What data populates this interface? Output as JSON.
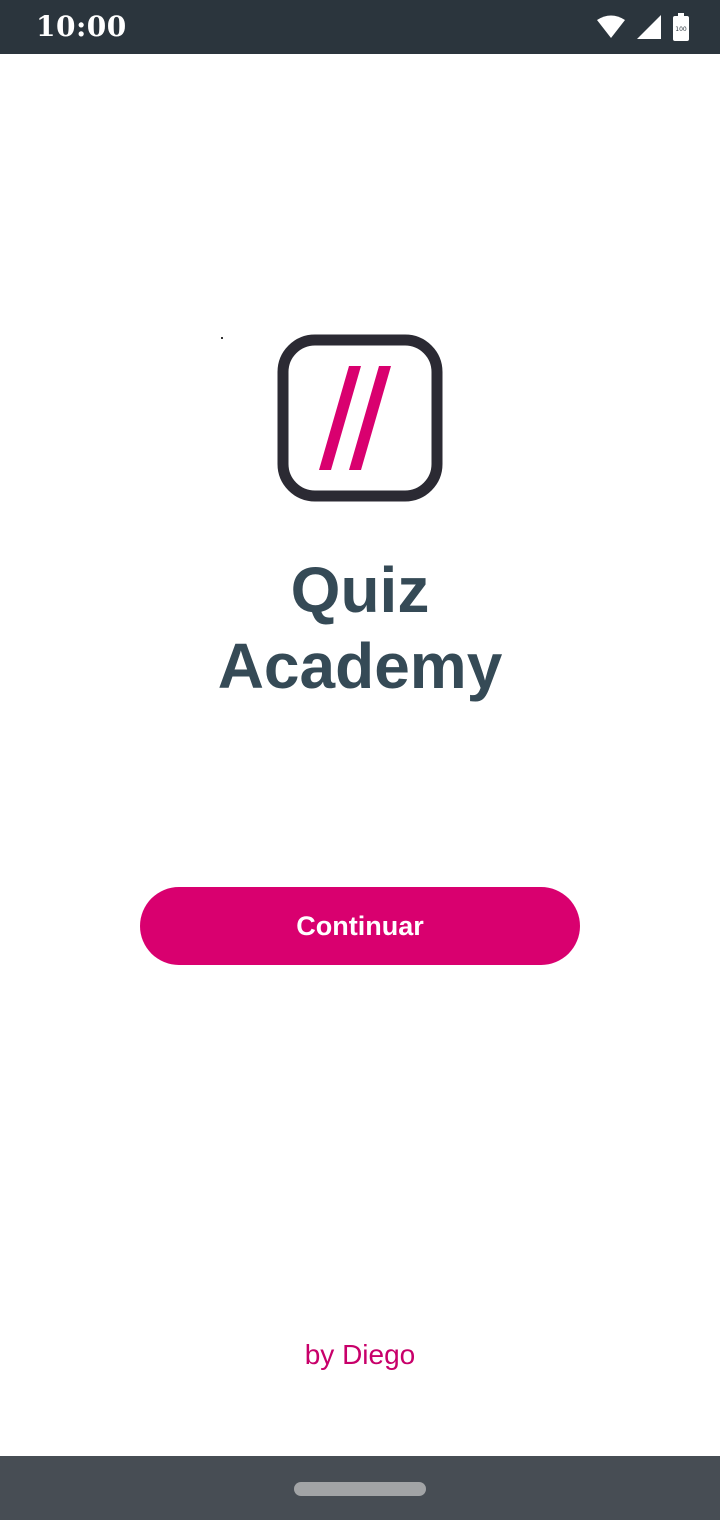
{
  "status_bar": {
    "time": "10:00",
    "battery_level": "100",
    "icons": [
      "wifi-icon",
      "cellular-signal-icon",
      "battery-icon"
    ]
  },
  "app": {
    "logo_icon": "double-slash-logo-icon",
    "title_line1": "Quiz",
    "title_line2": "Academy"
  },
  "actions": {
    "continue_label": "Continuar"
  },
  "footer": {
    "byline": "by Diego"
  },
  "colors": {
    "accent": "#d9006f",
    "title": "#354a56",
    "status_bar": "#2b353d",
    "nav_bar": "#474d54"
  }
}
